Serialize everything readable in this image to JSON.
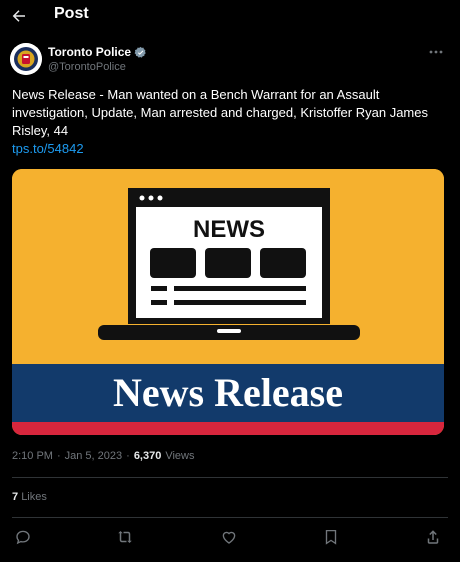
{
  "header": {
    "title": "Post",
    "back_icon": "arrow-left-icon"
  },
  "author": {
    "display_name": "Toronto Police",
    "handle": "@TorontoPolice",
    "verified": true,
    "avatar_icon": "toronto-police-crest-icon"
  },
  "post": {
    "text": "News Release - Man wanted on a Bench Warrant for an Assault investigation, Update, Man arrested and charged, Kristoffer Ryan James Risley, 44",
    "link": "tps.to/54842",
    "media": {
      "headline": "NEWS",
      "banner": "News Release",
      "colors": {
        "background": "#f5b12f",
        "banner": "#123a6b",
        "stripe": "#d7263d",
        "laptop": "#111111"
      }
    }
  },
  "meta": {
    "time": "2:10 PM",
    "separator": "·",
    "date": "Jan 5, 2023",
    "views_count": "6,370",
    "views_label": "Views"
  },
  "stats": {
    "likes_count": "7",
    "likes_label": "Likes"
  },
  "actions": [
    "reply-icon",
    "repost-icon",
    "like-icon",
    "bookmark-icon",
    "share-icon"
  ]
}
